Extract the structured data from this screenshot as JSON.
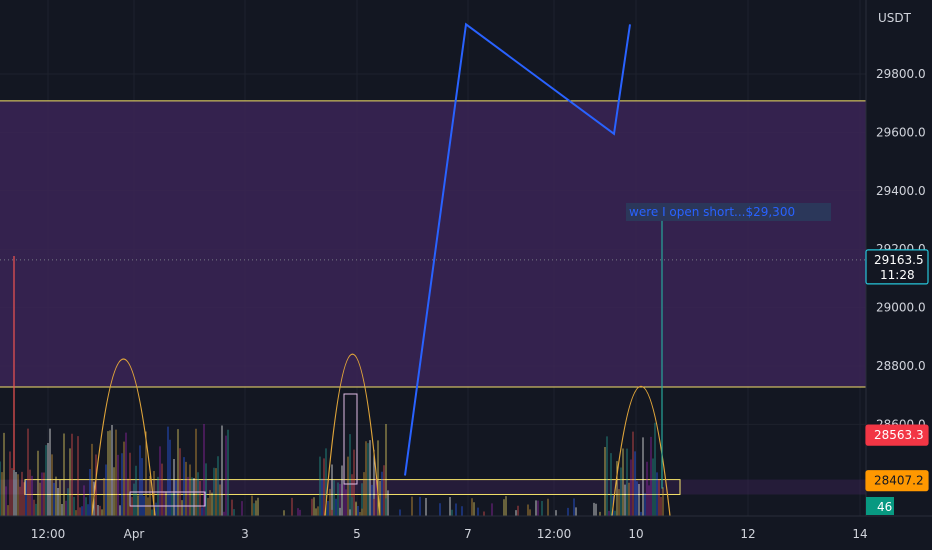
{
  "chart_data": {
    "type": "line",
    "title": "",
    "currency": "USDT",
    "y_axis": {
      "ticks": [
        28600.0,
        28800.0,
        29000.0,
        29200.0,
        29400.0,
        29600.0,
        29800.0
      ],
      "tick_labels": [
        "28600.0",
        "28800.0",
        "29000.0",
        "29200.0",
        "29400.0",
        "29600.0",
        "29800.0"
      ],
      "ylim": [
        28340,
        29970
      ]
    },
    "x_axis": {
      "tick_labels": [
        "12:00",
        "Apr",
        "3",
        "5",
        "7",
        "12:00",
        "10",
        "12",
        "14"
      ]
    },
    "zones": [
      {
        "name": "",
        "y_from": 28728,
        "y_to": 29708,
        "color": "#3b2456"
      },
      {
        "name": "",
        "y_from": 28360,
        "y_to": 28411,
        "color": "#3b2456"
      }
    ],
    "horizontal_lines": [
      {
        "value": 29708,
        "color": "#f5e26a"
      },
      {
        "value": 28728,
        "color": "#f5e26a"
      }
    ],
    "drawn_path": {
      "color": "#2962ff",
      "points": [
        {
          "x": "5",
          "y": 28425
        },
        {
          "x": "7",
          "y": 29970
        },
        {
          "x": "9",
          "y": 29595
        },
        {
          "x": "10",
          "y": 29970
        }
      ]
    },
    "spike": {
      "x": "10",
      "low": 28380,
      "high": 29300,
      "color": "#26a69a"
    },
    "annotation": {
      "text": "were I open short...$29,300",
      "price": 29300,
      "color": "#2962ff"
    },
    "price_tags": [
      {
        "label": "29163.5",
        "sub": "11:28",
        "value": 29163.5,
        "bg": "#131722",
        "border": "#26c6da",
        "fg": "#ffffff"
      },
      {
        "label": "28563.3",
        "sub": "",
        "value": 28563.3,
        "bg": "#f23645",
        "border": "#f23645",
        "fg": "#ffffff"
      },
      {
        "label": "28407.2",
        "sub": "",
        "value": 28407.2,
        "bg": "#ff9800",
        "border": "#ff9800",
        "fg": "#131722"
      }
    ],
    "indicator_tag": {
      "label": "46",
      "bg": "#089981",
      "fg": "#ffffff"
    },
    "current_price_line": 29163.5,
    "colors": {
      "background": "#131722",
      "grid": "#1e222d",
      "zone_border": "#f5e26a",
      "arc": "#e0a53a"
    }
  }
}
